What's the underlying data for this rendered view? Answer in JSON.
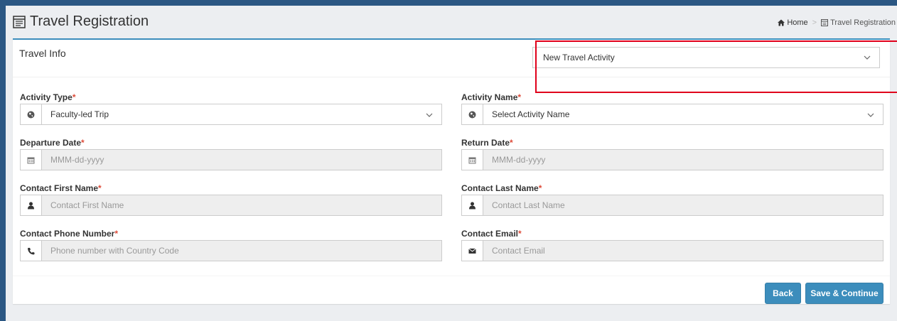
{
  "header": {
    "title": "Travel Registration",
    "breadcrumb": {
      "home": "Home",
      "current": "Travel Registration"
    }
  },
  "panel": {
    "title": "Travel Info",
    "travel_select": "New Travel Activity"
  },
  "form": {
    "activity_type": {
      "label": "Activity Type",
      "value": "Faculty-led Trip"
    },
    "activity_name": {
      "label": "Activity Name",
      "value": "Select Activity Name"
    },
    "departure_date": {
      "label": "Departure Date",
      "placeholder": "MMM-dd-yyyy"
    },
    "return_date": {
      "label": "Return Date",
      "placeholder": "MMM-dd-yyyy"
    },
    "contact_first_name": {
      "label": "Contact First Name",
      "placeholder": "Contact First Name"
    },
    "contact_last_name": {
      "label": "Contact Last Name",
      "placeholder": "Contact Last Name"
    },
    "contact_phone": {
      "label": "Contact Phone Number",
      "placeholder": "Phone number with Country Code"
    },
    "contact_email": {
      "label": "Contact Email",
      "placeholder": "Contact Email"
    },
    "required_mark": "*"
  },
  "buttons": {
    "back": "Back",
    "save_continue": "Save & Continue"
  },
  "colors": {
    "primary": "#3c8dbc",
    "required": "#dd4b39",
    "highlight": "#e0001b",
    "chrome": "#2b5783"
  }
}
